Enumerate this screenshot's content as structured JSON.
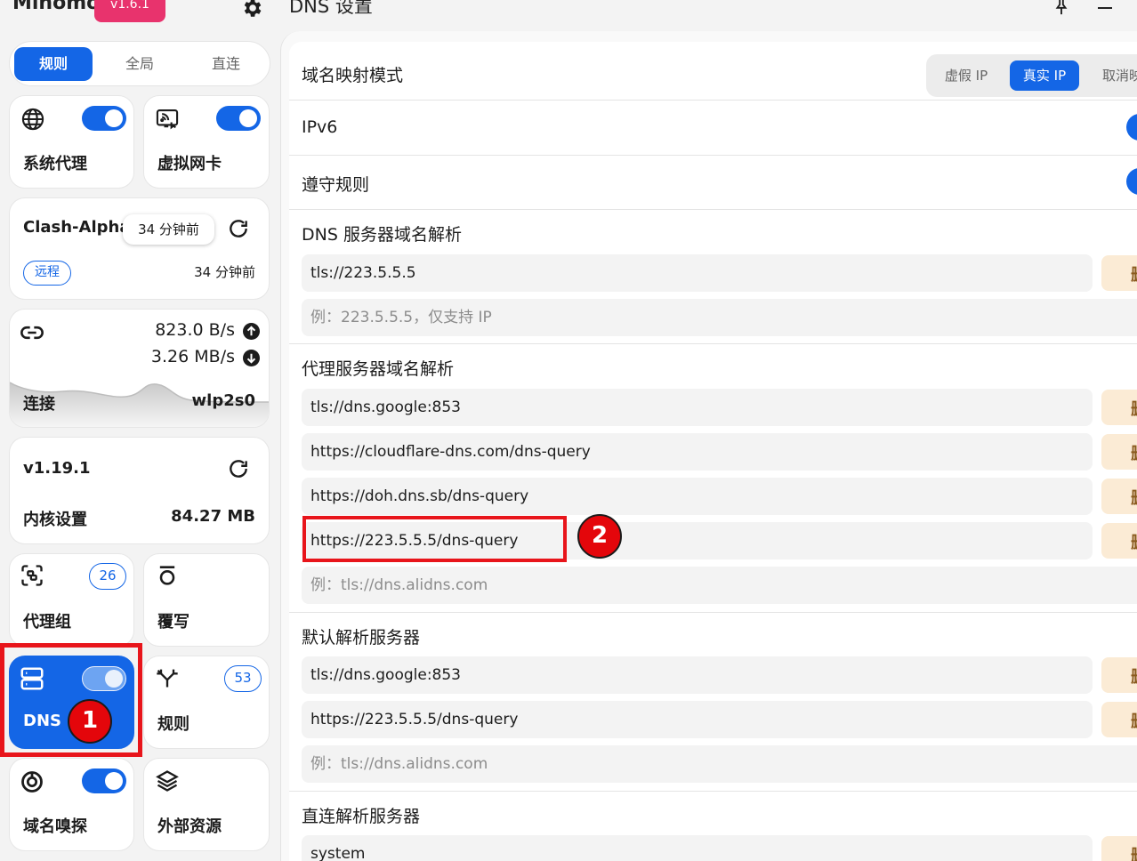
{
  "app": {
    "name": "Mihomo",
    "version": "v1.6.1"
  },
  "mode_tabs": [
    {
      "label": "规则"
    },
    {
      "label": "全局"
    },
    {
      "label": "直连"
    }
  ],
  "cards": {
    "system_proxy": {
      "label": "系统代理"
    },
    "tun": {
      "label": "虚拟网卡"
    },
    "profile": {
      "name": "Clash-Alpha",
      "tooltip": "34 分钟前",
      "tag": "远程",
      "updated": "34 分钟前"
    },
    "traffic": {
      "upload": "823.0 B/s",
      "download": "3.26 MB/s",
      "label": "连接",
      "interface": "wlp2s0"
    },
    "core": {
      "version": "v1.19.1",
      "label": "内核设置",
      "memory": "84.27 MB"
    },
    "proxy_groups": {
      "label": "代理组",
      "count": "26"
    },
    "override": {
      "label": "覆写"
    },
    "dns": {
      "label": "DNS"
    },
    "rules": {
      "label": "规则",
      "count": "53"
    },
    "sniffer": {
      "label": "域名嗅探"
    },
    "resources": {
      "label": "外部资源"
    }
  },
  "annotations": {
    "marker1": "1",
    "marker2": "2"
  },
  "main": {
    "title": "DNS 设置",
    "enhanced_mode": {
      "label": "域名映射模式",
      "options": [
        "虚假 IP",
        "真实 IP",
        "取消映"
      ],
      "selected": "真实 IP"
    },
    "ipv6": {
      "label": "IPv6"
    },
    "respect_rules": {
      "label": "遵守规则"
    },
    "default_nameserver": {
      "label": "DNS 服务器域名解析",
      "entries": [
        "tls://223.5.5.5"
      ],
      "placeholder": "例：223.5.5.5，仅支持 IP"
    },
    "proxy_nameserver": {
      "label": "代理服务器域名解析",
      "entries": [
        "tls://dns.google:853",
        "https://cloudflare-dns.com/dns-query",
        "https://doh.dns.sb/dns-query",
        "https://223.5.5.5/dns-query"
      ],
      "placeholder": "例：tls://dns.alidns.com"
    },
    "nameserver": {
      "label": "默认解析服务器",
      "entries": [
        "tls://dns.google:853",
        "https://223.5.5.5/dns-query"
      ],
      "placeholder": "例：tls://dns.alidns.com"
    },
    "direct_nameserver": {
      "label": "直连解析服务器",
      "entries": [
        "system"
      ]
    },
    "delete_glyph": "删"
  },
  "colors": {
    "accent": "#1466e6",
    "highlight": "#e8151b",
    "version_badge": "#e8336d",
    "delete_bg": "#fbebd5"
  },
  "icons": [
    "settings-gear-icon",
    "globe-icon",
    "monitor-network-icon",
    "refresh-icon",
    "link-icon",
    "arrow-up-icon",
    "arrow-down-icon",
    "focus-scan-icon",
    "override-icon",
    "server-icon",
    "fork-icon",
    "sniff-icon",
    "layers-icon",
    "pin-icon",
    "minimize-icon"
  ]
}
